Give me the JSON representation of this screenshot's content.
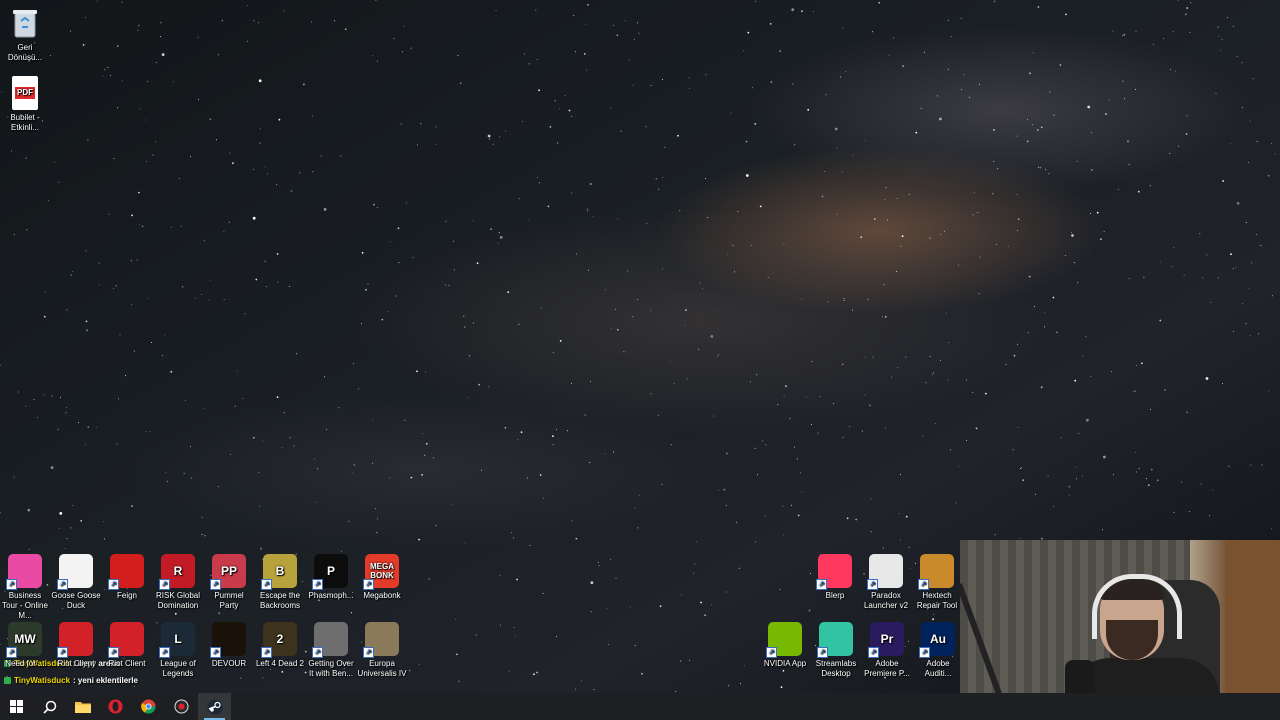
{
  "desktop": {
    "top_icons": [
      {
        "label": "Geri Dönüşü...",
        "icon": "recycle-bin-icon"
      },
      {
        "label": "Bubilet - Etkinli...",
        "icon": "pdf-file-icon",
        "badge": "PDF"
      }
    ],
    "bottom_row1": [
      {
        "label": "Business Tour - Online M...",
        "icon": "business-tour-icon",
        "color": "#e94aa3"
      },
      {
        "label": "Goose Goose Duck",
        "icon": "goose-goose-duck-icon",
        "color": "#f3f3f3"
      },
      {
        "label": "Feign",
        "icon": "feign-icon",
        "color": "#d41e1e"
      },
      {
        "label": "RISK Global Domination",
        "icon": "risk-icon",
        "color": "#c31b25",
        "badge": "R"
      },
      {
        "label": "Pummel Party",
        "icon": "pummel-party-icon",
        "color": "#c93a4a",
        "badge": "PP"
      },
      {
        "label": "Escape the Backrooms",
        "icon": "escape-backrooms-icon",
        "color": "#b8a23c",
        "badge": "B"
      },
      {
        "label": "Phasmoph...",
        "icon": "phasmophobia-icon",
        "color": "#0c0c0c",
        "badge": "P"
      },
      {
        "label": "Megabonk",
        "icon": "megabonk-icon",
        "color": "#e33b2a",
        "badge": "MEGA BONK"
      }
    ],
    "bottom_row2": [
      {
        "label": "Need for ...",
        "icon": "need-for-speed-icon",
        "color": "#2c3a2b",
        "badge": "MW"
      },
      {
        "label": "Riot Client",
        "icon": "riot-client-icon",
        "color": "#d3212a"
      },
      {
        "label": "Riot Client",
        "icon": "riot-client-icon",
        "color": "#d3212a"
      },
      {
        "label": "League of Legends",
        "icon": "league-of-legends-icon",
        "color": "#1b2a36",
        "badge": "L"
      },
      {
        "label": "DEVOUR",
        "icon": "devour-icon",
        "color": "#1a1208"
      },
      {
        "label": "Left 4 Dead 2",
        "icon": "left4dead2-icon",
        "color": "#3d331c",
        "badge": "2"
      },
      {
        "label": "Getting Over It with Ben...",
        "icon": "getting-over-it-icon",
        "color": "#6e6e6e"
      },
      {
        "label": "Europa Universalis IV",
        "icon": "europa-universalis-icon",
        "color": "#8a7a5a"
      }
    ],
    "right_row1": [
      {
        "label": "Blerp",
        "icon": "blerp-icon",
        "color": "#ff3860"
      },
      {
        "label": "Paradox Launcher v2",
        "icon": "paradox-launcher-icon",
        "color": "#e8e8e8"
      },
      {
        "label": "Hextech Repair Tool",
        "icon": "hextech-repair-icon",
        "color": "#c88a2a"
      }
    ],
    "right_row2": [
      {
        "label": "NVIDIA App",
        "icon": "nvidia-app-icon",
        "color": "#76b900"
      },
      {
        "label": "Streamlabs Desktop",
        "icon": "streamlabs-icon",
        "color": "#31c3a2"
      },
      {
        "label": "Adobe Premiere P...",
        "icon": "premiere-icon",
        "color": "#2a1a5e",
        "badge": "Pr"
      },
      {
        "label": "Adobe Auditi...",
        "icon": "audition-icon",
        "color": "#00235e",
        "badge": "Au"
      }
    ]
  },
  "chat": [
    {
      "user": "TinyWatisduck",
      "message": ": oyyy arena"
    },
    {
      "user": "TinyWatisduck",
      "message": ": yeni eklentilerle"
    }
  ],
  "taskbar": {
    "items": [
      {
        "name": "start-button",
        "icon": "windows-icon",
        "active": false
      },
      {
        "name": "search-button",
        "icon": "search-icon",
        "active": false
      },
      {
        "name": "file-explorer-button",
        "icon": "folder-icon",
        "active": false
      },
      {
        "name": "opera-button",
        "icon": "opera-icon",
        "active": false
      },
      {
        "name": "chrome-button",
        "icon": "chrome-icon",
        "active": false
      },
      {
        "name": "obs-button",
        "icon": "record-icon",
        "active": false
      },
      {
        "name": "steam-button",
        "icon": "steam-icon",
        "active": true
      }
    ]
  }
}
